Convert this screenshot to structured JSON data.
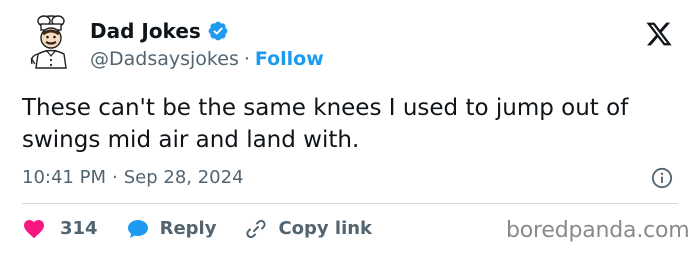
{
  "author": {
    "display_name": "Dad Jokes",
    "handle": "@Dadsaysjokes",
    "separator": "·",
    "follow_label": "Follow",
    "verified_color": "#1d9bf0",
    "avatar_icon": "cartoon-chef-avatar"
  },
  "tweet": {
    "text": "These can't be the same knees I used to jump out of swings mid air and land with.",
    "time": "10:41 PM",
    "meta_separator": "·",
    "date": "Sep 28, 2024"
  },
  "actions": {
    "like_count": "314",
    "reply_label": "Reply",
    "copy_label": "Copy link",
    "like_color": "#f91880",
    "reply_color": "#1d9bf0"
  },
  "platform_logo": "x-logo",
  "watermark": "boredpanda.com"
}
